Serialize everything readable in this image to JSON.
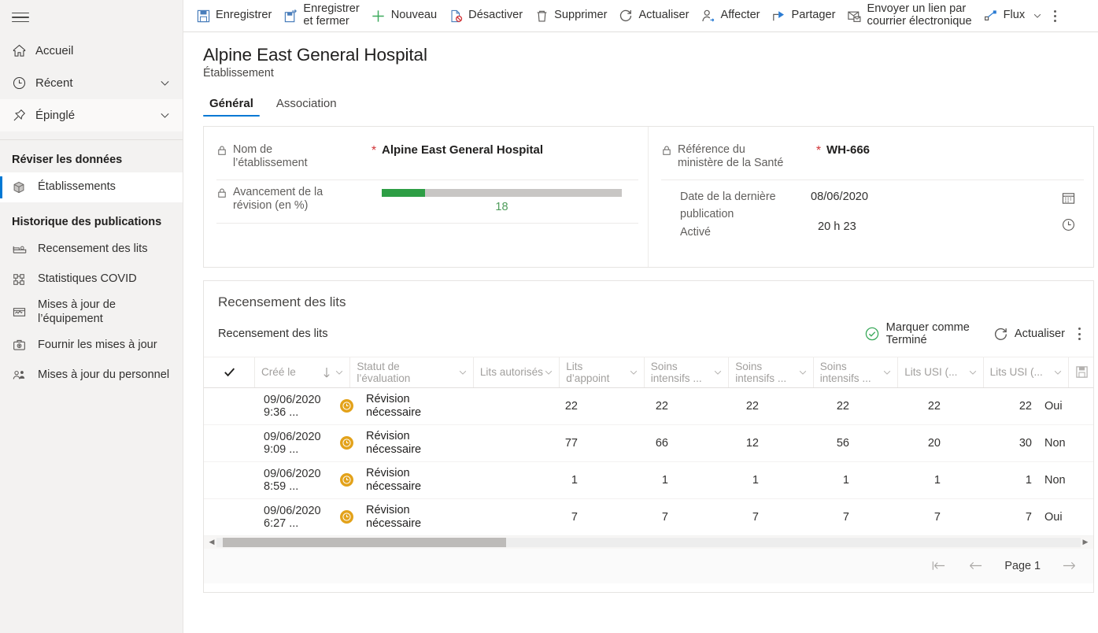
{
  "sidebar": {
    "menu_toggle": "hamburger-menu",
    "nav": [
      {
        "label": "Accueil",
        "icon": "home-icon",
        "chevron": false
      },
      {
        "label": "Récent",
        "icon": "clock-icon",
        "chevron": true
      },
      {
        "label": "Épinglé",
        "icon": "pin-icon",
        "chevron": true
      }
    ],
    "groups": [
      {
        "title": "Réviser les données",
        "items": [
          {
            "label": "Établissements",
            "icon": "cube-icon",
            "active": true
          }
        ]
      },
      {
        "title": "Historique des publications",
        "items": [
          {
            "label": "Recensement des lits",
            "icon": "bed-icon",
            "active": false
          },
          {
            "label": "Statistiques COVID",
            "icon": "covid-icon",
            "active": false
          },
          {
            "label": "Mises à jour de\nl’équipement",
            "icon": "equipment-icon",
            "active": false
          },
          {
            "label": "Fournir les mises à jour",
            "icon": "supplies-icon",
            "active": false
          },
          {
            "label": "Mises à jour\ndu personnel",
            "icon": "staff-icon",
            "active": false
          }
        ]
      }
    ]
  },
  "commandbar": {
    "items": [
      {
        "label": "Enregistrer",
        "icon": "save-icon",
        "two_line": false
      },
      {
        "label": "Enregistrer\net fermer",
        "icon": "save-and-close-icon",
        "two_line": true
      },
      {
        "label": "Nouveau",
        "icon": "plus-icon",
        "two_line": false
      },
      {
        "label": "Désactiver",
        "icon": "deactivate-icon",
        "two_line": false
      },
      {
        "label": "Supprimer",
        "icon": "trash-icon",
        "two_line": false
      },
      {
        "label": "Actualiser",
        "icon": "refresh-icon",
        "two_line": false
      },
      {
        "label": "Affecter",
        "icon": "assign-user-icon",
        "two_line": false
      },
      {
        "label": "Partager",
        "icon": "share-icon",
        "two_line": false
      },
      {
        "label": "Envoyer un lien par\ncourrier électronique",
        "icon": "email-link-icon",
        "two_line": true
      },
      {
        "label": "Flux",
        "icon": "flow-icon",
        "two_line": false,
        "chevron": true
      }
    ],
    "overflow": "more-commands-kebab"
  },
  "header": {
    "title": "Alpine East General Hospital",
    "subtitle": "Établissement",
    "tabs": [
      {
        "label": "Général",
        "selected": true
      },
      {
        "label": "Association",
        "selected": false
      }
    ]
  },
  "form": {
    "facility_name": {
      "label": "Nom de\nl’établissement",
      "required": "*",
      "value": "Alpine East General Hospital",
      "locked": true
    },
    "review_progress": {
      "label": "Avancement de la\nrévision (en %)",
      "value": "18",
      "percent": 18,
      "locked": true,
      "bar_color": "#2e9e45",
      "track_color": "#c8c6c4",
      "text_color": "#4f9c5b"
    },
    "health_ministry_ref": {
      "label": "Référence du\nministère de la Santé",
      "required": "*",
      "value": "WH-666",
      "locked": true
    },
    "last_published": {
      "label_line1": "Date de la dernière",
      "label_line2": "publication",
      "label_line3": "Activé",
      "date_value": "08/06/2020",
      "time_value": "20 h 23",
      "date_icon": "calendar-icon",
      "time_icon": "clock-icon"
    }
  },
  "grid": {
    "section_title": "Recensement des lits",
    "subgrid_name": "Recensement des lits",
    "actions": [
      {
        "label": "Marquer comme\nTerminé",
        "icon": "check-circle-icon",
        "color": "#2e9e45"
      },
      {
        "label": "Actualiser",
        "icon": "refresh-icon"
      }
    ],
    "overflow": "grid-more-commands-kebab",
    "columns": [
      {
        "label": "Créé le",
        "sorted": true,
        "sort_dir": "down",
        "menu": true
      },
      {
        "label": "Statut de\nl’évaluation",
        "menu": true
      },
      {
        "label": "Lits autorisés",
        "menu": true
      },
      {
        "label": "Lits d’appoint",
        "menu": true
      },
      {
        "label": "Soins\nintensifs ...",
        "menu": true
      },
      {
        "label": "Soins\nintensifs ...",
        "menu": true
      },
      {
        "label": "Soins\nintensifs ...",
        "menu": true
      },
      {
        "label": "Lits USI (...",
        "menu": true
      },
      {
        "label": "Lits USI (...",
        "menu": true
      }
    ],
    "save_icon": "save-grid-icon",
    "select_all_icon": "checkmark-icon",
    "rows": [
      {
        "created": "09/06/2020 9:36 ...",
        "status": "Révision\nnécessaire",
        "status_icon": "pending-clock-icon",
        "values": [
          "22",
          "22",
          "22",
          "22",
          "22",
          "22"
        ],
        "last": "Oui"
      },
      {
        "created": "09/06/2020 9:09 ...",
        "status": "Révision\nnécessaire",
        "status_icon": "pending-clock-icon",
        "values": [
          "77",
          "66",
          "12",
          "56",
          "20",
          "30"
        ],
        "last": "Non"
      },
      {
        "created": "09/06/2020 8:59 ...",
        "status": "Révision\nnécessaire",
        "status_icon": "pending-clock-icon",
        "values": [
          "1",
          "1",
          "1",
          "1",
          "1",
          "1"
        ],
        "last": "Non"
      },
      {
        "created": "09/06/2020 6:27 ...",
        "status": "Révision\nnécessaire",
        "status_icon": "pending-clock-icon",
        "values": [
          "7",
          "7",
          "7",
          "7",
          "7",
          "7"
        ],
        "last": "Oui"
      }
    ],
    "pager": {
      "first_icon": "first-page-icon",
      "prev_icon": "previous-page-icon",
      "page_label": "Page 1",
      "next_icon": "next-page-icon"
    },
    "hscroll": {
      "left_arrow": "scroll-left-arrow",
      "right_arrow": "scroll-right-arrow"
    }
  }
}
